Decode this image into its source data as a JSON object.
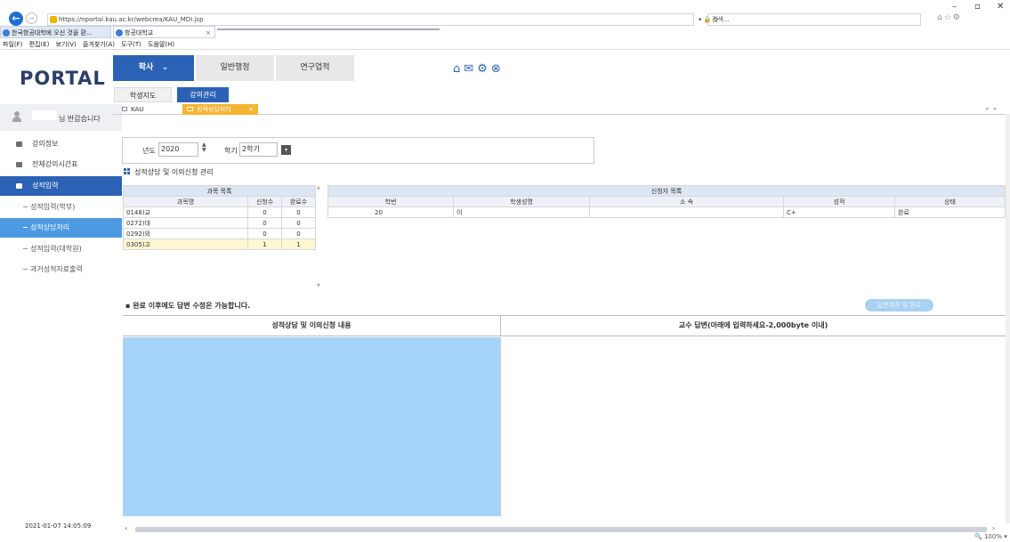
{
  "browser": {
    "url": "https://nportal.kau.ac.kr/webcrea/KAU_MDI.jsp",
    "search_placeholder": "검색...",
    "tabs": [
      {
        "label": "한국항공대학에 오신 것을 환..."
      },
      {
        "label": "항공대학교"
      }
    ],
    "menu": [
      "파일(F)",
      "편집(E)",
      "보기(V)",
      "즐겨찾기(A)",
      "도구(T)",
      "도움말(H)"
    ]
  },
  "sidebar": {
    "logo": "PORTAL",
    "greeting": "님 반갑습니다",
    "items": [
      {
        "label": "강의정보"
      },
      {
        "label": "전체강의시간표"
      },
      {
        "label": "성적입력"
      }
    ],
    "subitems": [
      {
        "label": "성적입력(학부)"
      },
      {
        "label": "성적상담처리"
      },
      {
        "label": "성적입력(대학원)"
      },
      {
        "label": "과거성적자료출력"
      }
    ],
    "datetime": "2021-01-07  14:05:09"
  },
  "modules": {
    "tabs": [
      {
        "label": "학사"
      },
      {
        "label": "일반행정"
      },
      {
        "label": "연구업적"
      }
    ],
    "subtabs": [
      {
        "label": "학생지도"
      },
      {
        "label": "강의관리"
      }
    ]
  },
  "page_tabs": [
    {
      "label": "KAU"
    },
    {
      "label": "성적상담처리"
    }
  ],
  "filter": {
    "year_label": "년도",
    "year_value": "2020",
    "semester_label": "학기",
    "semester_value": "2학기"
  },
  "section_title": "성적상담 및 이의신청 관리",
  "course_table": {
    "title": "과목 목록",
    "columns": [
      "과목명",
      "신청수",
      "완료수"
    ],
    "rows": [
      {
        "name": "0148)교",
        "applied": "0",
        "done": "0"
      },
      {
        "name": "0272)대",
        "applied": "0",
        "done": "0"
      },
      {
        "name": "0292)외",
        "applied": "0",
        "done": "0"
      },
      {
        "name": "0305)고",
        "applied": "1",
        "done": "1"
      }
    ]
  },
  "applicant_table": {
    "title": "신청자 목록",
    "columns": [
      "학번",
      "학생성명",
      "소 속",
      "성적",
      "상태"
    ],
    "rows": [
      {
        "id": "20",
        "name": "이",
        "dept": "",
        "grade": "C+",
        "status": "완료"
      }
    ]
  },
  "notice": "▪ 완료 이후에도 답변 수정은 가능합니다.",
  "answer_button": "답변저장 및 완료",
  "pane_left_title": "성적상담 및 이의신청 내용",
  "pane_right_title": "교수 답변(아래에 입력하세요-2,000byte 이내)",
  "zoom": "100%",
  "colors": {
    "primary": "#2b62b6",
    "highlight": "#a6d3fa",
    "tab_active": "#f5b533"
  }
}
